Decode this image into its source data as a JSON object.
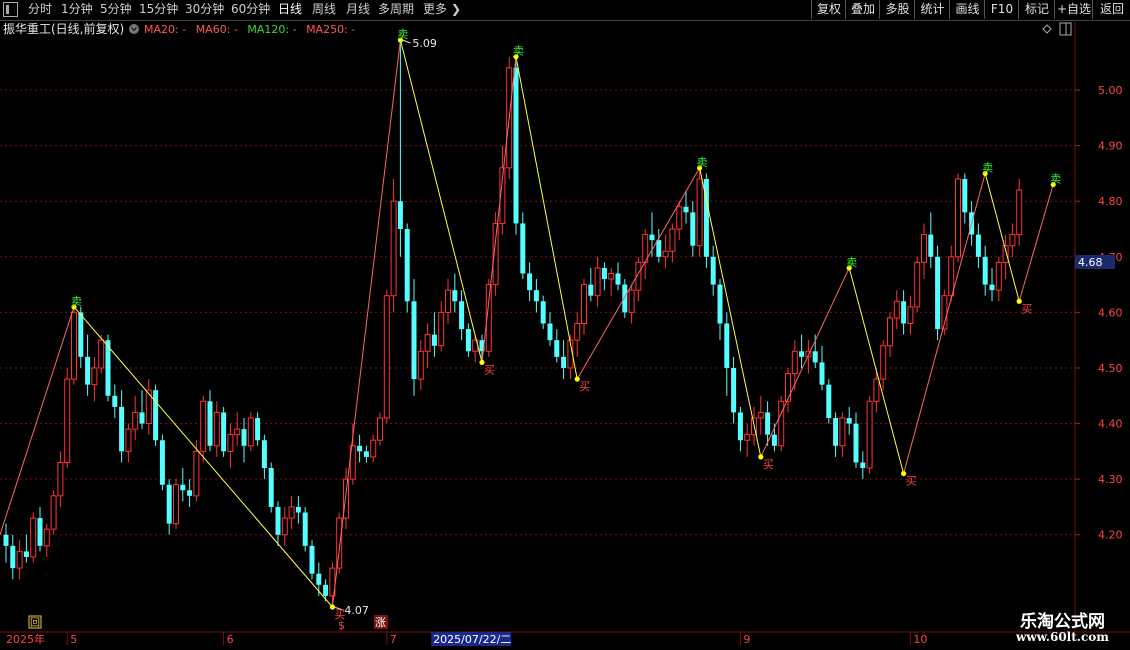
{
  "toolbar": {
    "menu_icon": "menu-square-icon",
    "periods": [
      "分时",
      "1分钟",
      "5分钟",
      "15分钟",
      "30分钟",
      "60分钟",
      "日线",
      "周线",
      "月线",
      "多周期",
      "更多"
    ],
    "active_period": "日线",
    "more_icon": "chevron-right-icon",
    "right_buttons": [
      "复权",
      "叠加",
      "多股",
      "统计",
      "画线",
      "F10",
      "标记",
      "+自选",
      "返回"
    ]
  },
  "info_bar": {
    "stock": "振华重工(日线,前复权)",
    "ma": [
      {
        "label": "MA20: -",
        "color": "#ff5555"
      },
      {
        "label": "MA60: -",
        "color": "#ff5555"
      },
      {
        "label": "MA120: -",
        "color": "#33dd33"
      },
      {
        "label": "MA250: -",
        "color": "#ff5555"
      }
    ]
  },
  "current_price": "4.68",
  "bottom_markers": {
    "left_box": "回",
    "dollar": "$",
    "zhang": "涨"
  },
  "watermark": {
    "line1": "乐淘公式网",
    "line2": "www.60lt.com"
  },
  "colors": {
    "up": "#ff3333",
    "down": "#54ffff",
    "zigzag_down": "#ffff44",
    "zigzag_up": "#ff6666",
    "grid": "#7a1010"
  },
  "chart_data": {
    "type": "candlestick",
    "title": "振华重工(日线,前复权)",
    "ylim": [
      4.1,
      5.1
    ],
    "y_ticks": [
      4.2,
      4.3,
      4.4,
      4.5,
      4.6,
      4.7,
      4.8,
      4.9,
      5.0
    ],
    "y_tick_labels": [
      "4.20",
      "4.30",
      "4.40",
      "4.50",
      "4.60",
      "4.70",
      "4.80",
      "4.90",
      "5.00"
    ],
    "x_labels": [
      {
        "index": 0,
        "label": "2025年"
      },
      {
        "index": 9,
        "label": "5"
      },
      {
        "index": 32,
        "label": "6"
      },
      {
        "index": 56,
        "label": "7"
      },
      {
        "index": 108,
        "label": "9"
      },
      {
        "index": 133,
        "label": "10"
      }
    ],
    "cursor_date": {
      "index": 74,
      "label": "2025/07/22/二"
    },
    "price_labels": [
      {
        "index": 58,
        "value": 5.09
      },
      {
        "index": 48,
        "value": 4.07
      }
    ],
    "signals": [
      {
        "index": 10,
        "type": "卖",
        "price": 4.61
      },
      {
        "index": 48,
        "type": "买",
        "price": 4.07
      },
      {
        "index": 58,
        "type": "卖",
        "price": 5.09
      },
      {
        "index": 70,
        "type": "买",
        "price": 4.51
      },
      {
        "index": 75,
        "type": "卖",
        "price": 5.06
      },
      {
        "index": 84,
        "type": "买",
        "price": 4.48
      },
      {
        "index": 102,
        "type": "卖",
        "price": 4.86
      },
      {
        "index": 111,
        "type": "买",
        "price": 4.34
      },
      {
        "index": 124,
        "type": "卖",
        "price": 4.68
      },
      {
        "index": 132,
        "type": "买",
        "price": 4.31
      },
      {
        "index": 144,
        "type": "卖",
        "price": 4.85
      },
      {
        "index": 149,
        "type": "买",
        "price": 4.62
      },
      {
        "index": 154,
        "type": "卖",
        "price": 4.83
      }
    ],
    "ohlc": [
      [
        4.2,
        4.22,
        4.15,
        4.18
      ],
      [
        4.18,
        4.2,
        4.12,
        4.14
      ],
      [
        4.14,
        4.19,
        4.12,
        4.17
      ],
      [
        4.17,
        4.2,
        4.15,
        4.16
      ],
      [
        4.16,
        4.24,
        4.15,
        4.23
      ],
      [
        4.23,
        4.25,
        4.17,
        4.18
      ],
      [
        4.18,
        4.22,
        4.16,
        4.21
      ],
      [
        4.21,
        4.28,
        4.2,
        4.27
      ],
      [
        4.27,
        4.35,
        4.25,
        4.33
      ],
      [
        4.33,
        4.5,
        4.32,
        4.48
      ],
      [
        4.48,
        4.61,
        4.47,
        4.6
      ],
      [
        4.6,
        4.61,
        4.5,
        4.52
      ],
      [
        4.52,
        4.56,
        4.45,
        4.47
      ],
      [
        4.47,
        4.52,
        4.44,
        4.5
      ],
      [
        4.5,
        4.56,
        4.49,
        4.55
      ],
      [
        4.55,
        4.56,
        4.44,
        4.45
      ],
      [
        4.45,
        4.47,
        4.41,
        4.43
      ],
      [
        4.43,
        4.46,
        4.33,
        4.35
      ],
      [
        4.35,
        4.4,
        4.33,
        4.39
      ],
      [
        4.39,
        4.45,
        4.37,
        4.42
      ],
      [
        4.42,
        4.46,
        4.39,
        4.4
      ],
      [
        4.4,
        4.48,
        4.38,
        4.46
      ],
      [
        4.46,
        4.47,
        4.36,
        4.37
      ],
      [
        4.37,
        4.38,
        4.28,
        4.29
      ],
      [
        4.29,
        4.3,
        4.2,
        4.22
      ],
      [
        4.22,
        4.3,
        4.21,
        4.29
      ],
      [
        4.29,
        4.32,
        4.26,
        4.28
      ],
      [
        4.28,
        4.3,
        4.25,
        4.27
      ],
      [
        4.27,
        4.37,
        4.26,
        4.35
      ],
      [
        4.35,
        4.45,
        4.33,
        4.44
      ],
      [
        4.44,
        4.46,
        4.35,
        4.36
      ],
      [
        4.36,
        4.44,
        4.34,
        4.42
      ],
      [
        4.42,
        4.43,
        4.34,
        4.35
      ],
      [
        4.35,
        4.4,
        4.32,
        4.38
      ],
      [
        4.38,
        4.42,
        4.36,
        4.39
      ],
      [
        4.39,
        4.41,
        4.33,
        4.36
      ],
      [
        4.36,
        4.42,
        4.35,
        4.41
      ],
      [
        4.41,
        4.42,
        4.36,
        4.37
      ],
      [
        4.37,
        4.38,
        4.3,
        4.32
      ],
      [
        4.32,
        4.33,
        4.24,
        4.25
      ],
      [
        4.25,
        4.26,
        4.18,
        4.2
      ],
      [
        4.2,
        4.25,
        4.18,
        4.23
      ],
      [
        4.23,
        4.27,
        4.21,
        4.25
      ],
      [
        4.25,
        4.27,
        4.22,
        4.24
      ],
      [
        4.24,
        4.25,
        4.17,
        4.18
      ],
      [
        4.18,
        4.19,
        4.12,
        4.13
      ],
      [
        4.13,
        4.15,
        4.09,
        4.11
      ],
      [
        4.11,
        4.12,
        4.08,
        4.09
      ],
      [
        4.09,
        4.15,
        4.07,
        4.14
      ],
      [
        4.14,
        4.24,
        4.13,
        4.23
      ],
      [
        4.23,
        4.32,
        4.21,
        4.3
      ],
      [
        4.3,
        4.4,
        4.29,
        4.36
      ],
      [
        4.36,
        4.38,
        4.33,
        4.35
      ],
      [
        4.35,
        4.36,
        4.33,
        4.34
      ],
      [
        4.34,
        4.38,
        4.33,
        4.37
      ],
      [
        4.37,
        4.42,
        4.36,
        4.41
      ],
      [
        4.41,
        4.64,
        4.4,
        4.63
      ],
      [
        4.63,
        4.84,
        4.6,
        4.8
      ],
      [
        4.8,
        5.09,
        4.7,
        4.75
      ],
      [
        4.75,
        4.76,
        4.6,
        4.62
      ],
      [
        4.62,
        4.66,
        4.45,
        4.48
      ],
      [
        4.48,
        4.55,
        4.46,
        4.53
      ],
      [
        4.53,
        4.58,
        4.5,
        4.56
      ],
      [
        4.56,
        4.6,
        4.52,
        4.54
      ],
      [
        4.54,
        4.62,
        4.53,
        4.6
      ],
      [
        4.6,
        4.66,
        4.58,
        4.64
      ],
      [
        4.64,
        4.67,
        4.6,
        4.62
      ],
      [
        4.62,
        4.64,
        4.55,
        4.57
      ],
      [
        4.57,
        4.58,
        4.52,
        4.53
      ],
      [
        4.53,
        4.56,
        4.51,
        4.55
      ],
      [
        4.55,
        4.56,
        4.51,
        4.53
      ],
      [
        4.53,
        4.66,
        4.52,
        4.65
      ],
      [
        4.65,
        4.78,
        4.63,
        4.76
      ],
      [
        4.76,
        4.9,
        4.74,
        4.86
      ],
      [
        4.86,
        5.06,
        4.84,
        5.04
      ],
      [
        5.04,
        5.05,
        4.74,
        4.76
      ],
      [
        4.76,
        4.78,
        4.66,
        4.67
      ],
      [
        4.67,
        4.69,
        4.62,
        4.64
      ],
      [
        4.64,
        4.66,
        4.6,
        4.62
      ],
      [
        4.62,
        4.63,
        4.57,
        4.58
      ],
      [
        4.58,
        4.6,
        4.54,
        4.55
      ],
      [
        4.55,
        4.57,
        4.51,
        4.52
      ],
      [
        4.52,
        4.55,
        4.48,
        4.5
      ],
      [
        4.5,
        4.56,
        4.48,
        4.55
      ],
      [
        4.55,
        4.6,
        4.52,
        4.58
      ],
      [
        4.58,
        4.66,
        4.56,
        4.65
      ],
      [
        4.65,
        4.68,
        4.62,
        4.63
      ],
      [
        4.63,
        4.7,
        4.61,
        4.68
      ],
      [
        4.68,
        4.69,
        4.64,
        4.66
      ],
      [
        4.66,
        4.68,
        4.63,
        4.67
      ],
      [
        4.67,
        4.69,
        4.64,
        4.65
      ],
      [
        4.65,
        4.66,
        4.59,
        4.6
      ],
      [
        4.6,
        4.65,
        4.58,
        4.64
      ],
      [
        4.64,
        4.7,
        4.62,
        4.69
      ],
      [
        4.69,
        4.75,
        4.66,
        4.74
      ],
      [
        4.74,
        4.78,
        4.7,
        4.73
      ],
      [
        4.73,
        4.75,
        4.69,
        4.7
      ],
      [
        4.7,
        4.74,
        4.68,
        4.71
      ],
      [
        4.71,
        4.76,
        4.69,
        4.75
      ],
      [
        4.75,
        4.8,
        4.73,
        4.79
      ],
      [
        4.79,
        4.82,
        4.76,
        4.78
      ],
      [
        4.78,
        4.8,
        4.7,
        4.72
      ],
      [
        4.72,
        4.86,
        4.7,
        4.84
      ],
      [
        4.84,
        4.85,
        4.68,
        4.7
      ],
      [
        4.7,
        4.72,
        4.63,
        4.65
      ],
      [
        4.65,
        4.66,
        4.55,
        4.58
      ],
      [
        4.58,
        4.6,
        4.45,
        4.5
      ],
      [
        4.5,
        4.52,
        4.4,
        4.42
      ],
      [
        4.42,
        4.43,
        4.35,
        4.37
      ],
      [
        4.37,
        4.4,
        4.34,
        4.38
      ],
      [
        4.38,
        4.43,
        4.36,
        4.41
      ],
      [
        4.41,
        4.45,
        4.38,
        4.42
      ],
      [
        4.42,
        4.44,
        4.36,
        4.38
      ],
      [
        4.38,
        4.4,
        4.35,
        4.36
      ],
      [
        4.36,
        4.45,
        4.35,
        4.44
      ],
      [
        4.44,
        4.5,
        4.42,
        4.49
      ],
      [
        4.49,
        4.55,
        4.46,
        4.53
      ],
      [
        4.53,
        4.56,
        4.5,
        4.52
      ],
      [
        4.52,
        4.55,
        4.49,
        4.53
      ],
      [
        4.53,
        4.56,
        4.5,
        4.51
      ],
      [
        4.51,
        4.54,
        4.46,
        4.47
      ],
      [
        4.47,
        4.48,
        4.4,
        4.41
      ],
      [
        4.41,
        4.42,
        4.34,
        4.36
      ],
      [
        4.36,
        4.42,
        4.34,
        4.41
      ],
      [
        4.41,
        4.43,
        4.38,
        4.4
      ],
      [
        4.4,
        4.42,
        4.32,
        4.33
      ],
      [
        4.33,
        4.35,
        4.3,
        4.32
      ],
      [
        4.32,
        4.45,
        4.31,
        4.44
      ],
      [
        4.44,
        4.5,
        4.42,
        4.48
      ],
      [
        4.48,
        4.55,
        4.46,
        4.54
      ],
      [
        4.54,
        4.6,
        4.52,
        4.59
      ],
      [
        4.59,
        4.64,
        4.57,
        4.62
      ],
      [
        4.62,
        4.64,
        4.56,
        4.58
      ],
      [
        4.58,
        4.63,
        4.56,
        4.61
      ],
      [
        4.61,
        4.7,
        4.6,
        4.69
      ],
      [
        4.69,
        4.76,
        4.66,
        4.74
      ],
      [
        4.74,
        4.78,
        4.68,
        4.7
      ],
      [
        4.7,
        4.72,
        4.55,
        4.57
      ],
      [
        4.57,
        4.64,
        4.56,
        4.63
      ],
      [
        4.63,
        4.72,
        4.62,
        4.7
      ],
      [
        4.7,
        4.85,
        4.69,
        4.84
      ],
      [
        4.84,
        4.85,
        4.76,
        4.78
      ],
      [
        4.78,
        4.8,
        4.72,
        4.74
      ],
      [
        4.74,
        4.76,
        4.68,
        4.7
      ],
      [
        4.7,
        4.72,
        4.63,
        4.65
      ],
      [
        4.65,
        4.68,
        4.62,
        4.64
      ],
      [
        4.64,
        4.7,
        4.62,
        4.69
      ],
      [
        4.69,
        4.74,
        4.66,
        4.72
      ],
      [
        4.72,
        4.76,
        4.7,
        4.74
      ],
      [
        4.74,
        4.84,
        4.72,
        4.82
      ]
    ]
  }
}
